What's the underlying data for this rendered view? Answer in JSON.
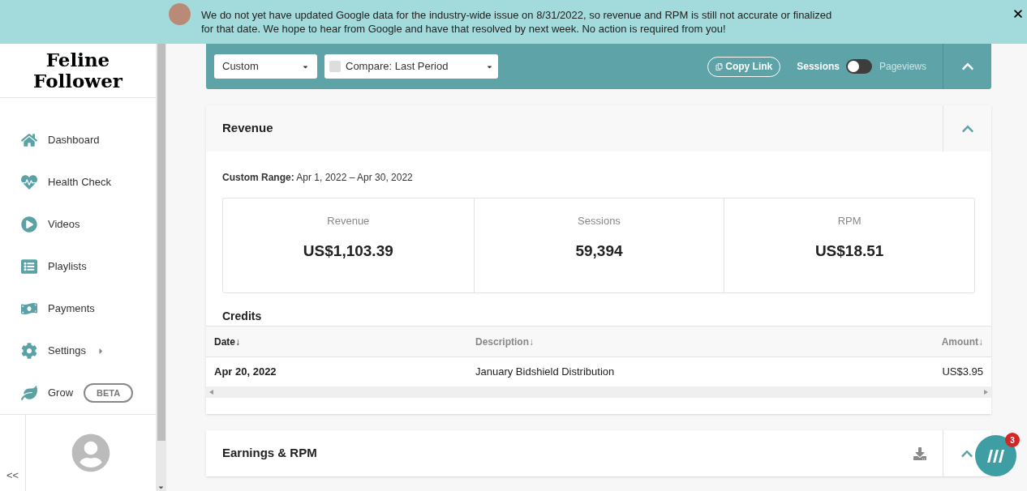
{
  "banner": {
    "text": "We do not yet have updated Google data for the industry-wide issue on 8/31/2022, so revenue and RPM is still not accurate or finalized for that date. We hope to hear from Google and have that resolved by next week.  No action is required from you!"
  },
  "sidebar": {
    "logo": "Feline Follower",
    "items": [
      {
        "kind": "home",
        "label": "Dashboard",
        "selected": false
      },
      {
        "kind": "heart",
        "label": "Health Check",
        "selected": false
      },
      {
        "kind": "play",
        "label": "Videos",
        "selected": false
      },
      {
        "kind": "list",
        "label": "Playlists",
        "selected": false
      },
      {
        "kind": "bag",
        "label": "Payments",
        "selected": false
      },
      {
        "kind": "gear",
        "label": "Settings",
        "selected": false,
        "submenu": true
      },
      {
        "kind": "leaf",
        "label": "Grow",
        "selected": false,
        "badge": "BETA"
      }
    ],
    "collapse": "<<"
  },
  "toolbar": {
    "range": "Custom",
    "compare": {
      "label": "Compare: Last Period",
      "checked": false
    },
    "copy_link": "Copy Link",
    "toggle": {
      "left": "Sessions",
      "right": "Pageviews",
      "on": false
    }
  },
  "revenue": {
    "title": "Revenue",
    "range_label": "Custom Range:",
    "range": "Apr 1, 2022 – Apr 30, 2022",
    "stats": [
      {
        "label": "Revenue",
        "value": "US$1,103.39"
      },
      {
        "label": "Sessions",
        "value": "59,394"
      },
      {
        "label": "RPM",
        "value": "US$18.51"
      }
    ],
    "credits": {
      "title": "Credits",
      "columns": [
        "Date↓",
        "Description↓",
        "Amount↓"
      ],
      "rows": [
        [
          "Apr 20, 2022",
          "January Bidshield Distribution",
          "US$3.95"
        ]
      ]
    }
  },
  "earnings": {
    "title": "Earnings & RPM"
  },
  "chat": {
    "count": "3"
  }
}
